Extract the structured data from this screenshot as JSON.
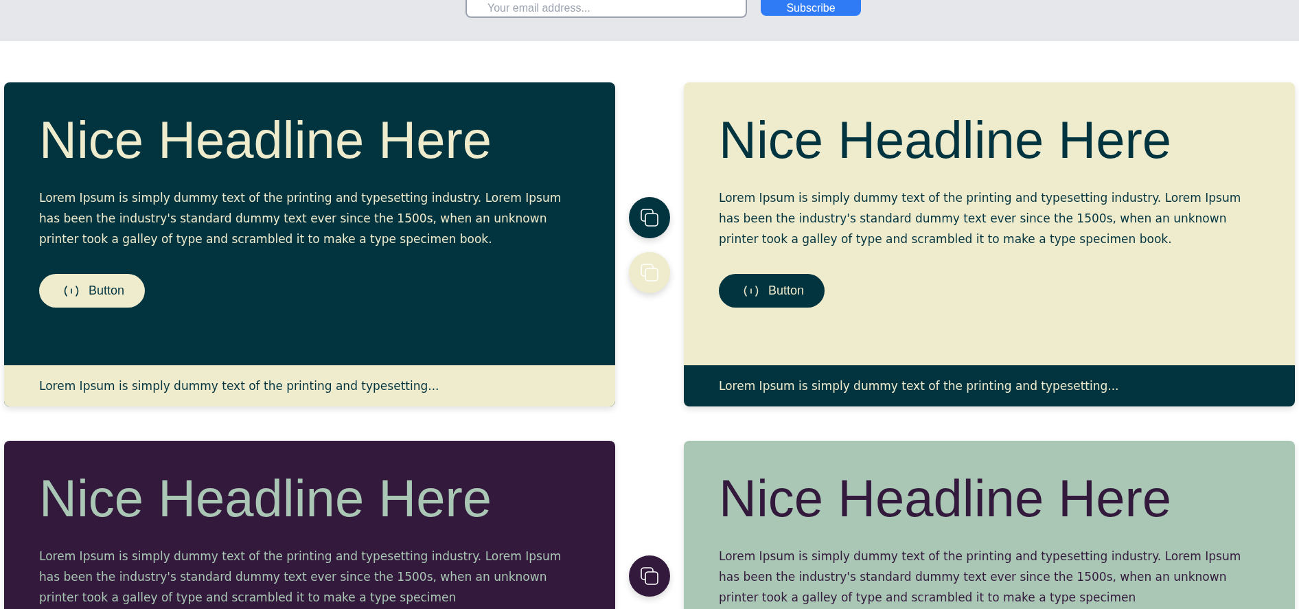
{
  "subscribe_bar": {
    "email_field": {
      "placeholder": "Your email address..."
    },
    "button": "Subscribe"
  },
  "rows": [
    {
      "cards": [
        {
          "color": "#023440",
          "accent": {
            "color": "#efebcd"
          },
          "headline": "Nice Headline Here",
          "text": "Lorem Ipsum is simply dummy text of the printing and typesetting industry. Lorem Ipsum has been the industry's standard dummy text ever since the 1500s, when an unknown printer took a galley of type and scrambled it to make a type specimen book.",
          "button": "Button",
          "footer": "Lorem Ipsum is simply dummy text of the printing and typesetting..."
        },
        {
          "color": "#efebcd",
          "accent": {
            "color": "#023440"
          },
          "headline": "Nice Headline Here",
          "text": "Lorem Ipsum is simply dummy text of the printing and typesetting industry. Lorem Ipsum has been the industry's standard dummy text ever since the 1500s, when an unknown printer took a galley of type and scrambled it to make a type specimen book.",
          "button": "Button",
          "footer": "Lorem Ipsum is simply dummy text of the printing and typesetting..."
        }
      ],
      "side_buttons": [
        {
          "color": "#023440"
        },
        {
          "color": "#efebcd"
        }
      ]
    },
    {
      "cards": [
        {
          "color": "#331a3d",
          "accent": {
            "color": "#aac6b4"
          },
          "headline": "Nice Headline Here",
          "text": "Lorem Ipsum is simply dummy text of the printing and typesetting industry. Lorem Ipsum has been the industry's standard dummy text ever since the 1500s, when an unknown printer took a galley of type and scrambled it to make a type specimen"
        },
        {
          "color": "#aac6b4",
          "accent": {
            "color": "#331a3d"
          },
          "headline": "Nice Headline Here",
          "text": "Lorem Ipsum is simply dummy text of the printing and typesetting industry. Lorem Ipsum has been the industry's standard dummy text ever since the 1500s, when an unknown printer took a galley of type and scrambled it to make a type specimen"
        }
      ],
      "side_buttons": [
        {
          "color": "#331a3d"
        }
      ]
    }
  ]
}
